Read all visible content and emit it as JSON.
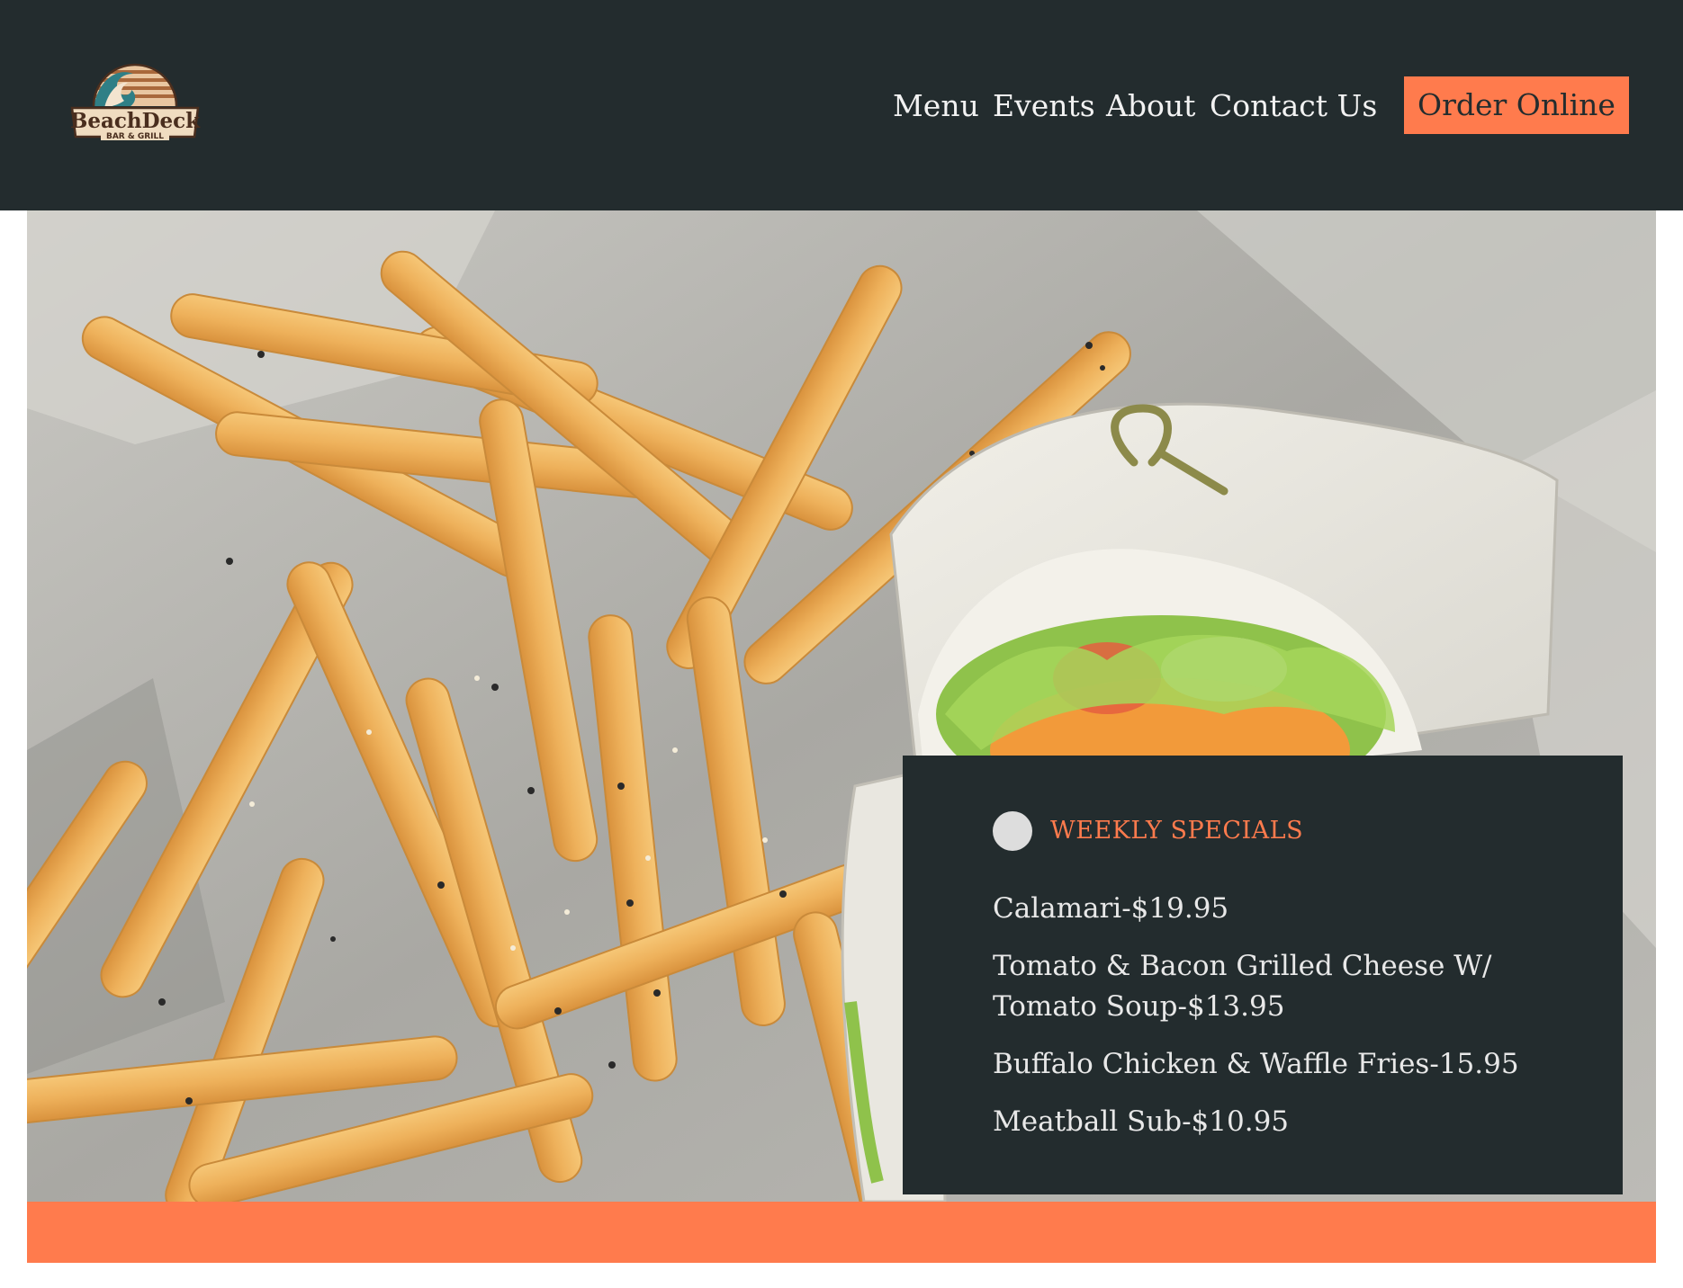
{
  "brand": {
    "logo_line1": "BeachDeck",
    "logo_line2": "BAR & GRILL",
    "logo_icon": "wave-sunset-icon"
  },
  "nav": {
    "items": [
      {
        "label": "Menu"
      },
      {
        "label": "Events"
      },
      {
        "label": "About"
      },
      {
        "label": "Contact Us"
      }
    ],
    "cta_label": "Order Online"
  },
  "specials": {
    "heading": "WEEKLY SPECIALS",
    "items": [
      "Calamari-$19.95",
      "Tomato & Bacon Grilled Cheese W/ Tomato Soup-$13.95",
      "Buffalo Chicken & Waffle Fries-15.95",
      "Meatball Sub-$10.95"
    ]
  },
  "colors": {
    "header_bg": "#232c2e",
    "accent": "#ff7b4d",
    "card_bg": "#232c2e",
    "text_light": "#f2f2f2"
  }
}
